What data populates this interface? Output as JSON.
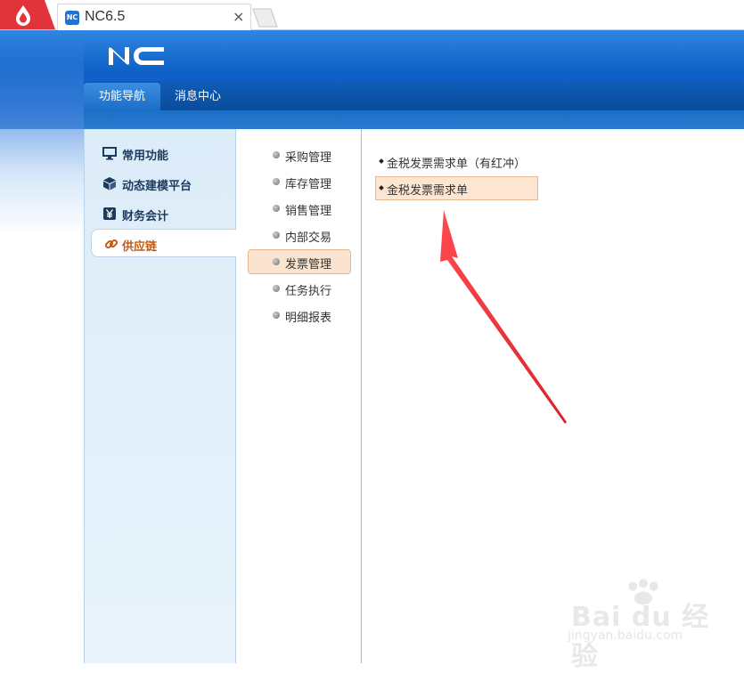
{
  "browser": {
    "tab_title": "NC6.5",
    "tab_favicon_text": "NC",
    "close_glyph": "×"
  },
  "header": {
    "logo_text": "NC",
    "nav_tabs": [
      {
        "label": "功能导航",
        "active": true
      },
      {
        "label": "消息中心",
        "active": false
      }
    ]
  },
  "categories": [
    {
      "label": "常用功能",
      "icon": "monitor-icon"
    },
    {
      "label": "动态建模平台",
      "icon": "cube-icon"
    },
    {
      "label": "财务会计",
      "icon": "yen-icon"
    },
    {
      "label": "供应链",
      "icon": "link-icon",
      "selected": true
    }
  ],
  "modules": [
    {
      "label": "采购管理"
    },
    {
      "label": "库存管理"
    },
    {
      "label": "销售管理"
    },
    {
      "label": "内部交易"
    },
    {
      "label": "发票管理",
      "selected": true
    },
    {
      "label": "任务执行"
    },
    {
      "label": "明细报表"
    }
  ],
  "functions": [
    {
      "label": "金税发票需求单（有红冲）"
    },
    {
      "label": "金税发票需求单",
      "selected": true
    }
  ],
  "watermark": {
    "brand": "Bai du 经验",
    "url": "jingyan.baidu.com"
  },
  "colors": {
    "header_blue": "#0f62c9",
    "selected_orange_bg": "#fbe4cf",
    "selected_orange_text": "#c85a10",
    "arrow_red": "#e8303a"
  }
}
